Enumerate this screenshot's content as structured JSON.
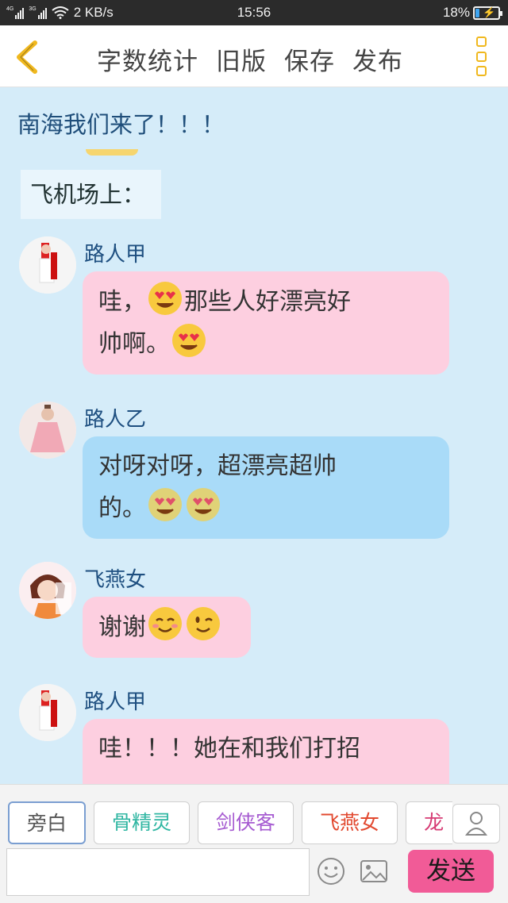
{
  "status_bar": {
    "net_left": "4G",
    "net_right": "3G",
    "speed": "2 KB/s",
    "time": "15:56",
    "battery_text": "18%",
    "battery_level": 0.18
  },
  "header": {
    "actions": [
      "字数统计",
      "旧版",
      "保存",
      "发布"
    ]
  },
  "story": {
    "title": "南海我们来了！！！",
    "narration": "飞机场上："
  },
  "messages": [
    {
      "name": "路人甲",
      "text1": "哇，",
      "text2": "那些人好漂亮好",
      "text3": "帅啊。"
    },
    {
      "name": "路人乙",
      "text1": "对呀对呀，超漂亮超帅",
      "text2": "的。"
    },
    {
      "name": "飞燕女",
      "text1": "谢谢"
    },
    {
      "name": "路人甲",
      "text1": "哇！！！她在和我们打招"
    }
  ],
  "roles": [
    {
      "label": "旁白",
      "color": "#555555"
    },
    {
      "label": "骨精灵",
      "color": "#2fb6a2"
    },
    {
      "label": "剑侠客",
      "color": "#a65bd1"
    },
    {
      "label": "飞燕女",
      "color": "#e2492f"
    },
    {
      "label": "龙",
      "color": "#d63a73"
    }
  ],
  "input": {
    "value": "",
    "placeholder": ""
  },
  "send_label": "发送",
  "colors": {
    "accent": "#f0b81e",
    "send": "#f15b97",
    "pink_bubble": "#fdcfe0",
    "blue_bubble": "#a9dbf8"
  }
}
